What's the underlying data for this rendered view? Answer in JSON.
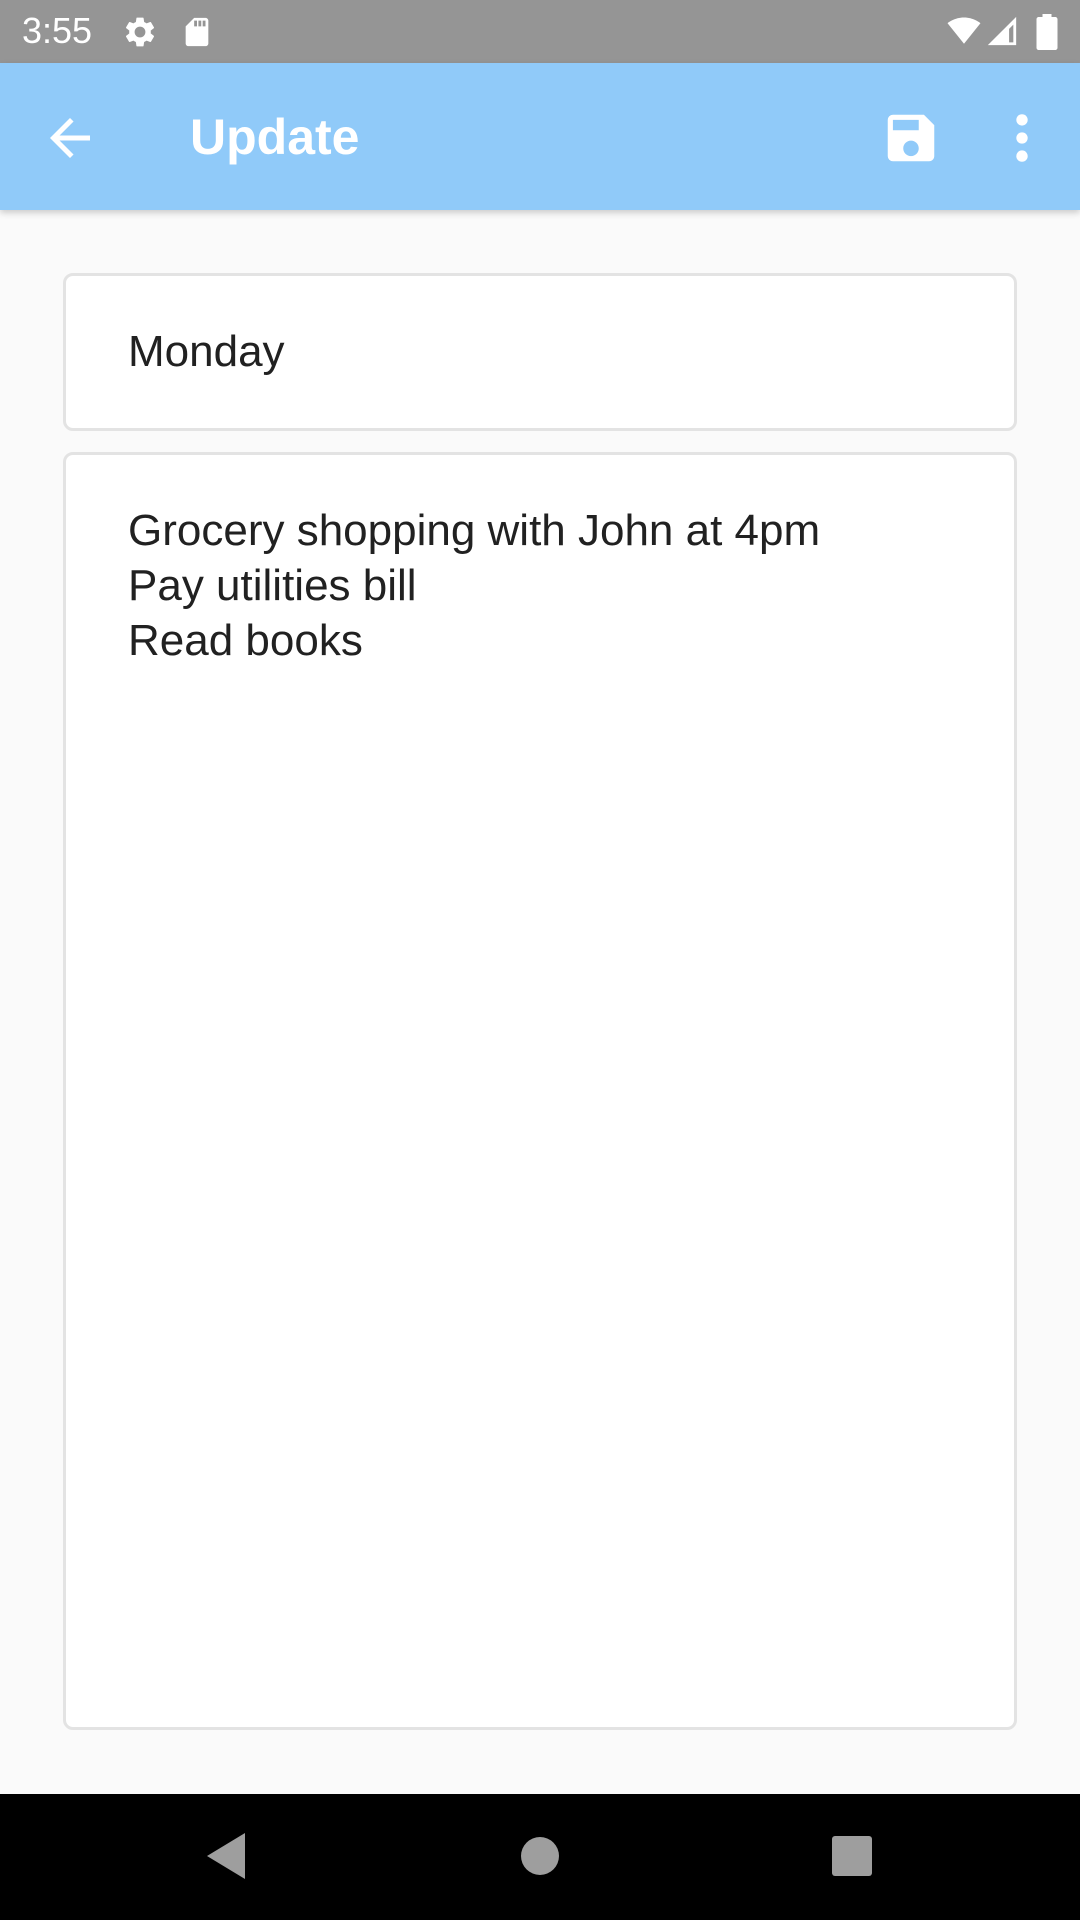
{
  "status_bar": {
    "time": "3:55",
    "icons": [
      "settings-icon",
      "sd-card-icon",
      "wifi-icon",
      "cell-signal-icon",
      "battery-icon"
    ]
  },
  "app_bar": {
    "title": "Update",
    "back_icon": "arrow-back-icon",
    "save_icon": "save-icon",
    "more_icon": "more-vert-icon",
    "color": "#90caf9"
  },
  "note": {
    "title": "Monday",
    "content_lines": [
      "Grocery shopping with John at 4pm",
      "Pay utilities bill",
      "Read books"
    ]
  },
  "nav_bar": {
    "icons": [
      "back-triangle-icon",
      "home-circle-icon",
      "recents-square-icon"
    ]
  }
}
